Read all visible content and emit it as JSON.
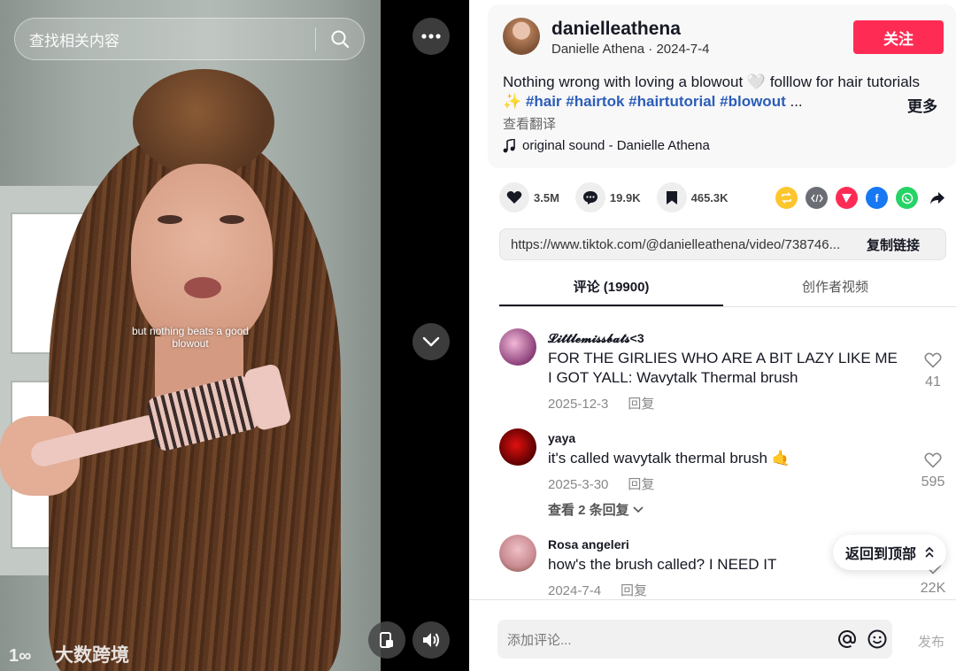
{
  "video": {
    "search_placeholder": "查找相关内容",
    "caption": "but nothing beats a good blowout",
    "watermark": "大数跨境"
  },
  "author": {
    "username": "danielleathena",
    "display_name": "Danielle Athena",
    "separator": " · ",
    "date": "2024-7-4",
    "follow_label": "关注"
  },
  "description": {
    "text": "Nothing wrong with loving a blowout 🤍 folllow for hair tutorials ✨",
    "tags": [
      "#hair",
      "#hairtok",
      "#hairtutorial",
      "#blowout"
    ],
    "ellipsis": "...",
    "more_label": "更多",
    "translate_label": "查看翻译",
    "music": "original sound - Danielle Athena"
  },
  "actions": {
    "likes": "3.5M",
    "comments": "19.9K",
    "saves": "465.3K"
  },
  "share": {
    "url": "https://www.tiktok.com/@danielleathena/video/738746...",
    "copy_label": "复制链接"
  },
  "tabs": [
    {
      "label": "评论 (19900)",
      "active": true
    },
    {
      "label": "创作者视频",
      "active": false
    }
  ],
  "comments": [
    {
      "name": "𝓛𝓲𝓽𝓽𝓵𝓮𝓶𝓲𝓼𝓼𝓫𝓪𝓽𝓼<3",
      "text": "FOR THE GIRLIES WHO ARE A BIT LAZY LIKE ME I GOT YALL: Wavytalk Thermal brush",
      "date": "2025-12-3",
      "reply_label": "回复",
      "likes": "41"
    },
    {
      "name": "yaya",
      "text": "it's called wavytalk thermal brush 🤙",
      "date": "2025-3-30",
      "reply_label": "回复",
      "likes": "595",
      "view_replies": "查看 2 条回复"
    },
    {
      "name": "Rosa angeleri",
      "text": "how's the brush called? I NEED IT",
      "date": "2024-7-4",
      "reply_label": "回复",
      "likes": "22K"
    }
  ],
  "back_to_top": "返回到顶部",
  "bottom": {
    "comment_placeholder": "添加评论...",
    "post_label": "发布"
  },
  "colors": {
    "accent": "#fe2c55",
    "hashtag": "#2b5db9"
  }
}
